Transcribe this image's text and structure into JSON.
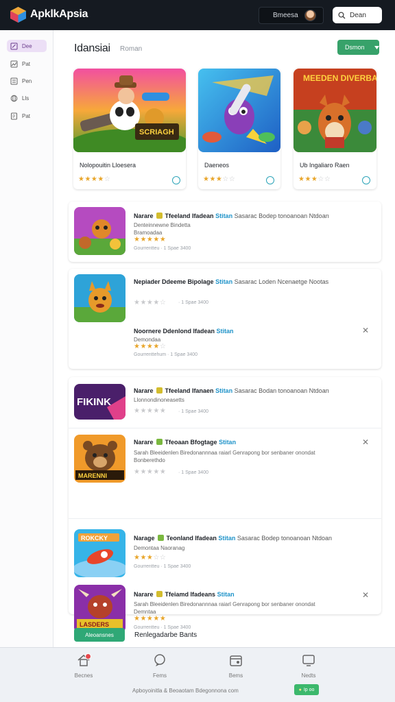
{
  "header": {
    "brand": "ApklkApsia",
    "account_label": "Bmeesa",
    "search_label": "Dean"
  },
  "sidebar": {
    "items": [
      {
        "label": "Dee",
        "icon": "edit-icon",
        "active": true
      },
      {
        "label": "Pat",
        "icon": "chart-icon",
        "active": false
      },
      {
        "label": "Pen",
        "icon": "list-icon",
        "active": false
      },
      {
        "label": "Lls",
        "icon": "globe-icon",
        "active": false
      },
      {
        "label": "Pat",
        "icon": "document-icon",
        "active": false
      }
    ]
  },
  "main": {
    "title": "Idansiai",
    "subtitle": "Roman",
    "filter_label": "Dsmon"
  },
  "featured": [
    {
      "name": "Nolopouitin Lloesera",
      "rating": 4,
      "icon": "panda-hunter-game-art"
    },
    {
      "name": "Daeneos",
      "rating": 3,
      "icon": "rocket-monster-game-art"
    },
    {
      "name": "Ub Ingaliaro Raen",
      "rating": 3,
      "icon": "fox-adventure-game-art"
    }
  ],
  "featured_banner_text": "MEEDEN DIVERBARN",
  "featured_art_text": "SCRIAGH",
  "apps": [
    {
      "title_a": "Narare",
      "title_b": "Tfeeland Ifadean",
      "link": "Stitan",
      "rest": "Sasarac Bodep tonoanoan Ntdoan",
      "desc": [
        "Denteinnewne Bindetta",
        "Bramoadaa"
      ],
      "rating": 5,
      "meta": "Gourrentteu · 1 Spae 3400",
      "tag": "y",
      "close": false
    },
    {
      "title_a": "Nepiader Ddeeme Bipolage",
      "title_b": "",
      "link": "Stitan",
      "rest": "Sasarac Loden Ncenaetge Nootas",
      "desc": [],
      "rating": 4,
      "meta": "· 1 Spae 3400",
      "tag": "",
      "close": false
    },
    {
      "title_a": "Noornere Ddenlond Ifadean",
      "title_b": "",
      "link": "Stitan",
      "rest": "",
      "desc": [
        "Demondaa"
      ],
      "rating": 3,
      "meta": "Gourrenttehum · 1 Spae 3400",
      "tag": "",
      "close": true
    },
    {
      "title_a": "Narare",
      "title_b": "Tfeeland Ifanaen",
      "link": "Stitan",
      "rest": "Sasarac Bodan tonoanoan Ntdoan",
      "desc": [
        "Llonnondinoneasetts"
      ],
      "rating": 0,
      "meta": "· 1 Spae 3400",
      "tag": "y",
      "close": false
    },
    {
      "title_a": "Narare",
      "title_b": "Tfeoaan Bfogtage",
      "link": "Stitan",
      "rest": "",
      "desc": [
        "Sarah Bleeidenlen Biredonannnaa raiarl Genrapong bor senbaner onondat",
        "Bonberethdo"
      ],
      "rating": 0,
      "meta": "· 1 Spae 3400",
      "tag": "g",
      "close": true
    },
    {
      "title_a": "Narage",
      "title_b": "Teonland Ifadean",
      "link": "Stitan",
      "rest": "Sasarac Bodep tonoanoan Ntdoan",
      "desc": [
        "Demontaa Naoranag"
      ],
      "rating": 3,
      "meta": "Gourrentteu · 1 Spae 3400",
      "tag": "g",
      "close": false
    },
    {
      "title_a": "Narare",
      "title_b": "Tfeiamd Ifadeans",
      "link": "Stitan",
      "rest": "",
      "desc": [
        "Sarah Bleeidenlen Biredonannnaa raiarl Genrapong bor senbaner onondat",
        "Demntaa"
      ],
      "rating": 5,
      "meta": "Gourrentteu · 1 Spae 3400",
      "tag": "y",
      "close": true
    }
  ],
  "app_art_text": {
    "fikink": "FIKINK",
    "bear": "MARENNI",
    "rocket": "ROKCKY",
    "bull": "LASDERS"
  },
  "cta": {
    "button": "Aleoansnes",
    "text": "Renlegadarbe Bants"
  },
  "bottom_nav": {
    "tabs": [
      {
        "label": "Becnes",
        "icon": "home-icon"
      },
      {
        "label": "Fems",
        "icon": "chat-icon"
      },
      {
        "label": "Bems",
        "icon": "calendar-icon"
      },
      {
        "label": "Nedts",
        "icon": "tv-icon"
      }
    ],
    "footer_text": "Apboyoinitla & Beoaotam Bdegonnona com",
    "footer_chip": "Ip oo",
    "badge_color": "#e5484d"
  },
  "colors": {
    "accent": "#37a26a",
    "header": "#151a21",
    "link": "#1f93c9",
    "star": "#e8a52a"
  }
}
